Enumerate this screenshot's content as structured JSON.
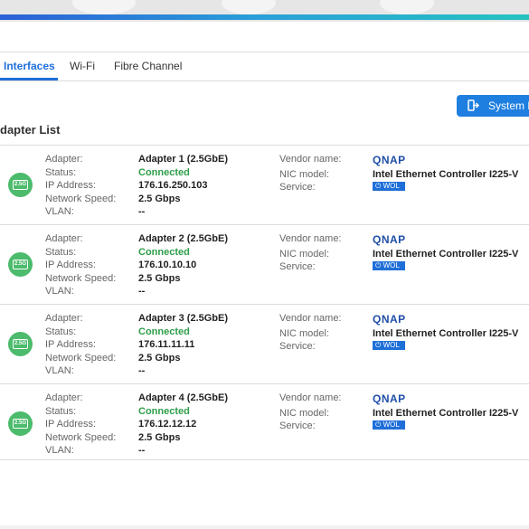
{
  "tabs": [
    {
      "label": "Interfaces"
    },
    {
      "label": "Wi-Fi"
    },
    {
      "label": "Fibre Channel"
    }
  ],
  "system_button": {
    "label": "System D",
    "icon": "exit-icon"
  },
  "section": {
    "title": "dapter List"
  },
  "field_labels": {
    "adapter": "Adapter:",
    "status": "Status:",
    "ip": "IP Address:",
    "speed": "Network Speed:",
    "vlan": "VLAN:",
    "vendor": "Vendor name:",
    "nic": "NIC model:",
    "service": "Service:"
  },
  "adapter_icon_text": "2.5G",
  "colors": {
    "accent": "#1f6fd8",
    "connected": "#2e9e48",
    "icon_bg": "#4cbb6c"
  },
  "adapters": [
    {
      "name": "Adapter 1 (2.5GbE)",
      "status": "Connected",
      "ip": "176.16.250.103",
      "speed": "2.5 Gbps",
      "vlan": "--",
      "vendor": "QNAP",
      "nic": "Intel Ethernet Controller I225-V",
      "service": "WOL"
    },
    {
      "name": "Adapter 2 (2.5GbE)",
      "status": "Connected",
      "ip": "176.10.10.10",
      "speed": "2.5 Gbps",
      "vlan": "--",
      "vendor": "QNAP",
      "nic": "Intel Ethernet Controller I225-V",
      "service": "WOL"
    },
    {
      "name": "Adapter 3 (2.5GbE)",
      "status": "Connected",
      "ip": "176.11.11.11",
      "speed": "2.5 Gbps",
      "vlan": "--",
      "vendor": "QNAP",
      "nic": "Intel Ethernet Controller I225-V",
      "service": "WOL"
    },
    {
      "name": "Adapter 4 (2.5GbE)",
      "status": "Connected",
      "ip": "176.12.12.12",
      "speed": "2.5 Gbps",
      "vlan": "--",
      "vendor": "QNAP",
      "nic": "Intel Ethernet Controller I225-V",
      "service": "WOL"
    }
  ]
}
